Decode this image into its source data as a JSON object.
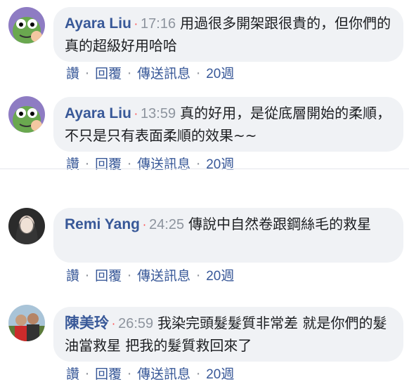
{
  "comments": [
    {
      "author": "Ayara Liu",
      "time": "17:16",
      "text": "用過很多開架跟很貴的，但你們的真的超級好用哈哈",
      "actions": {
        "like": "讚",
        "reply": "回覆",
        "message": "傳送訊息",
        "age": "20週"
      }
    },
    {
      "author": "Ayara Liu",
      "time": "13:59",
      "text": "真的好用，是從底層開始的柔順，不只是只有表面柔順的效果~~",
      "actions": {
        "like": "讚",
        "reply": "回覆",
        "message": "傳送訊息",
        "age": "20週"
      }
    },
    {
      "author": "Remi Yang",
      "time": "24:25",
      "text": "傳說中自然卷跟鋼絲毛的救星",
      "actions": {
        "like": "讚",
        "reply": "回覆",
        "message": "傳送訊息",
        "age": "20週"
      }
    },
    {
      "author": "陳美玲",
      "time": "26:59",
      "text": "我染完頭髮髮質非常差 就是你們的髮油當救星 把我的髮質救回來了",
      "actions": {
        "like": "讚",
        "reply": "回覆",
        "message": "傳送訊息",
        "age": "20週"
      }
    }
  ],
  "separator": "·",
  "colors": {
    "name": "#385898",
    "time": "#8d949e",
    "dot": "#ff4a4a",
    "bubble": "#f0f2f5"
  }
}
